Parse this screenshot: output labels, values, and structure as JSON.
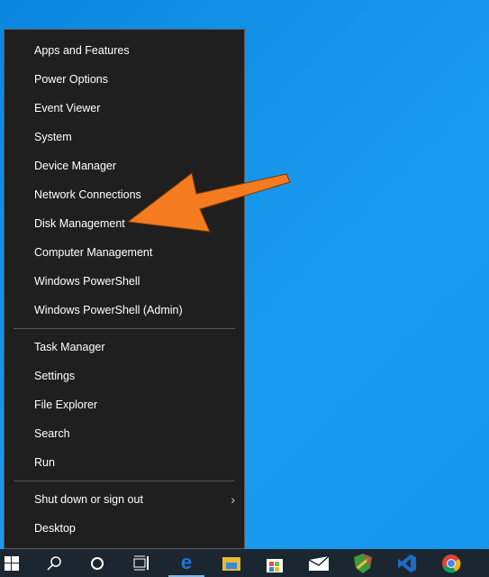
{
  "menu": {
    "group1": [
      "Apps and Features",
      "Power Options",
      "Event Viewer",
      "System",
      "Device Manager",
      "Network Connections",
      "Disk Management",
      "Computer Management",
      "Windows PowerShell",
      "Windows PowerShell (Admin)"
    ],
    "group2": [
      "Task Manager",
      "Settings",
      "File Explorer",
      "Search",
      "Run"
    ],
    "group3": [
      "Shut down or sign out",
      "Desktop"
    ]
  },
  "annotation": {
    "color": "#f47b20",
    "points_to": "Disk Management"
  },
  "taskbar": {
    "icons": [
      "windows-start-icon",
      "search-icon",
      "cortana-icon",
      "task-view-icon",
      "edge-icon",
      "file-explorer-icon",
      "store-icon",
      "mail-icon",
      "maps-icon",
      "vscode-icon",
      "chrome-icon"
    ]
  }
}
